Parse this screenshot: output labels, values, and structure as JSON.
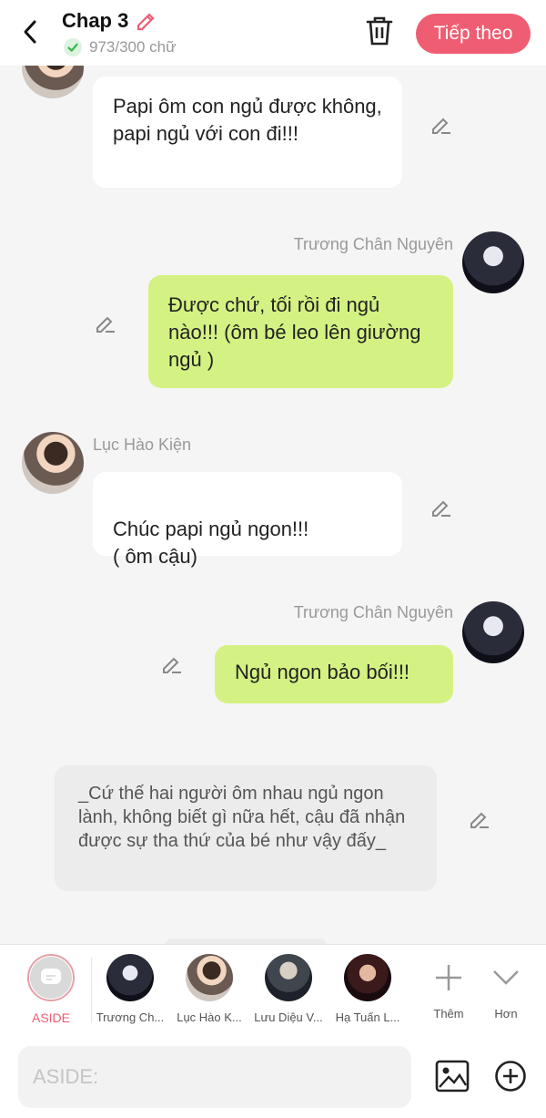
{
  "header": {
    "title": "Chap 3",
    "word_count": "973/300 chữ",
    "next_label": "Tiếp theo"
  },
  "messages": [
    {
      "text": "Papi ôm con ngủ được không, papi ngủ với con đi!!!"
    },
    {
      "sender": "Trương Chân Nguyên",
      "text": "Được chứ, tối rồi đi ngủ nào!!! (ôm bé leo lên giường ngủ )"
    },
    {
      "sender": "Lục Hào Kiện",
      "text": "Chúc papi ngủ ngon!!!\n( ôm cậu)"
    },
    {
      "sender": "Trương Chân Nguyên",
      "text": "Ngủ ngon bảo bối!!!"
    },
    {
      "text": "_Cứ thế hai người ôm nhau ngủ ngon lành, không biết gì nữa hết, cậu đã nhận được sự tha thứ của bé như vậy đấy_"
    }
  ],
  "characters": {
    "aside": "ASIDE",
    "list": [
      {
        "label": "Trương Ch..."
      },
      {
        "label": "Lục Hào K..."
      },
      {
        "label": "Lưu Diệu V..."
      },
      {
        "label": "Hạ Tuấn L..."
      }
    ],
    "more": "Thêm",
    "expand": "Hơn"
  },
  "input": {
    "placeholder": "ASIDE:"
  },
  "colors": {
    "accent": "#ef5d72",
    "green_bubble": "#d4f283",
    "check": "#3ab54a"
  },
  "icons": [
    "back-arrow",
    "pencil",
    "check",
    "trash",
    "edit",
    "plus",
    "chevron-down",
    "image",
    "circle-plus"
  ]
}
